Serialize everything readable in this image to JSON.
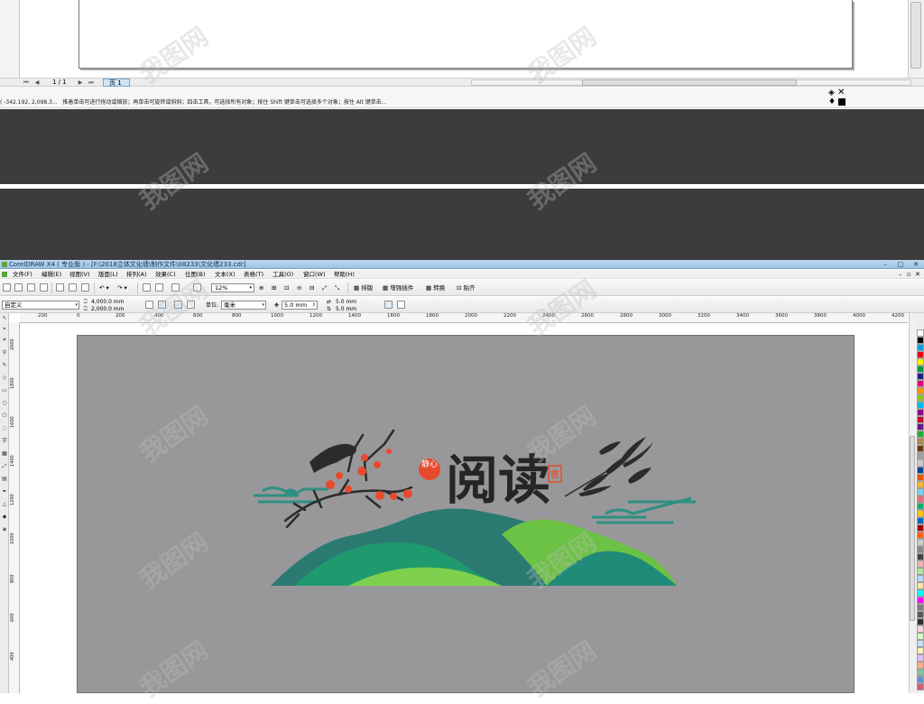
{
  "top_window": {
    "page_counter": "1 / 1",
    "page_tab": "页 1",
    "status_coords": "( -342.192, 2,098.3...",
    "status_hint": "推着单击可进行拖动或缩放；再单击可旋转或斜斜；四击工具，可选择所有对象；按住 Shift 键单击可选择多个对象；按住 Alt 键单击..."
  },
  "app": {
    "title": "CorelDRAW X4 ( 专业版 ) - [F:\\2018立体文化墙\\制作文件\\08233\\文化墙233.cdr]",
    "menu": [
      "文件(F)",
      "编辑(E)",
      "视图(V)",
      "版面(L)",
      "排列(A)",
      "效果(C)",
      "位图(B)",
      "文本(X)",
      "表格(T)",
      "工具(O)",
      "窗口(W)",
      "帮助(H)"
    ],
    "toolbar": {
      "zoom": "12%",
      "buttons": [
        "排版",
        "增强插件",
        "转换",
        "贴齐"
      ]
    },
    "property_bar": {
      "paper_preset": "自定义",
      "width": "4,000.0 mm",
      "height": "2,000.0 mm",
      "units_label": "单位:",
      "units_value": "毫米",
      "nudge": "5.0 mm",
      "dup_x": "5.0 mm",
      "dup_y": "5.0 mm"
    },
    "ruler_h": [
      "200",
      "0",
      "200",
      "400",
      "600",
      "800",
      "1000",
      "1200",
      "1400",
      "1600",
      "1800",
      "2000",
      "2200",
      "2400",
      "2600",
      "2800",
      "3000",
      "3200",
      "3400",
      "3600",
      "3800",
      "4000",
      "4200"
    ],
    "ruler_v": [
      "2000",
      "1800",
      "1600",
      "1400",
      "1200",
      "1000",
      "800",
      "600",
      "400"
    ],
    "palette": [
      "#ffffff",
      "#000000",
      "#00a0e9",
      "#e60012",
      "#fff100",
      "#009944",
      "#1d2088",
      "#e4007f",
      "#f39800",
      "#8fc31f",
      "#00b7ee",
      "#920783",
      "#c30d23",
      "#601986",
      "#22ac38",
      "#b28850",
      "#6a3906",
      "#9fa0a0",
      "#c9caca",
      "#00479d",
      "#ea5504",
      "#f8b62d",
      "#7ecef4",
      "#eb6877",
      "#13ae67",
      "#fcc800",
      "#0068b7",
      "#a40000",
      "#ff6600",
      "#cccccc",
      "#888888",
      "#444444",
      "#f5b2b2",
      "#aee6a0",
      "#b5d8ff",
      "#ffe4a0",
      "#00ffff",
      "#ff00ff",
      "#7d7d7d",
      "#5a5a5a",
      "#2f2f2f",
      "#ffd5e5",
      "#d0ffc0",
      "#c0e0ff",
      "#fff0b0",
      "#e0c0ff",
      "#ffb080",
      "#80c0a0",
      "#6090d0",
      "#d06070"
    ]
  },
  "artwork": {
    "title": "阅读",
    "seal": "静心",
    "stamp": "書"
  },
  "watermark": "我图网"
}
